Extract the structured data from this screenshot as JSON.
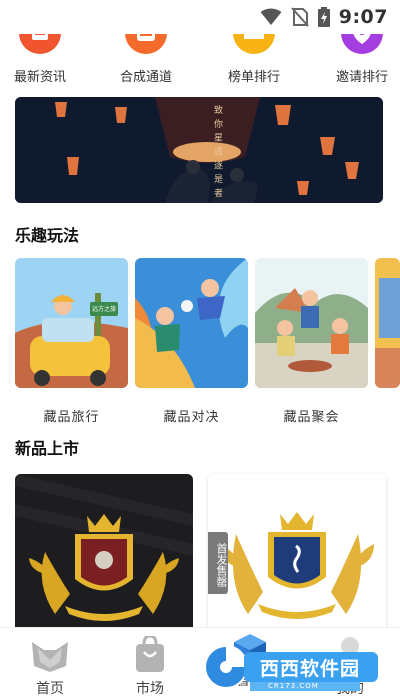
{
  "status_bar": {
    "time": "9:07"
  },
  "quick_nav": [
    {
      "label": "最新资讯",
      "icon": "news-icon",
      "color": "#f0552f"
    },
    {
      "label": "合成通道",
      "icon": "compose-icon",
      "color": "#f46a2b"
    },
    {
      "label": "榜单排行",
      "icon": "crown-icon",
      "color": "#f7b313"
    },
    {
      "label": "邀请排行",
      "icon": "invite-icon",
      "color": "#a53ee0"
    }
  ],
  "banner": {
    "text": "致 你 星 追 逐 是 者"
  },
  "sections": {
    "fun": "乐趣玩法",
    "new": "新品上市"
  },
  "play_cards": [
    {
      "label": "藏品旅行",
      "sign": "远方之旅"
    },
    {
      "label": "藏品对决"
    },
    {
      "label": "藏品聚会"
    }
  ],
  "new_items": [
    {
      "theme": "dark"
    },
    {
      "theme": "light",
      "badge": "首发售罄"
    }
  ],
  "tabs": [
    {
      "label": "首页",
      "icon": "home-fox-icon"
    },
    {
      "label": "市场",
      "icon": "market-bag-icon"
    },
    {
      "label": "盲盒",
      "icon": "blind-box-icon"
    },
    {
      "label": "我的",
      "icon": "profile-icon"
    }
  ],
  "watermark": {
    "text": "西西软件园",
    "sub": "CR173.COM"
  },
  "colors": {
    "accent_highlight": "#a9d5f5",
    "banner_bg": "#0f1a2e"
  }
}
